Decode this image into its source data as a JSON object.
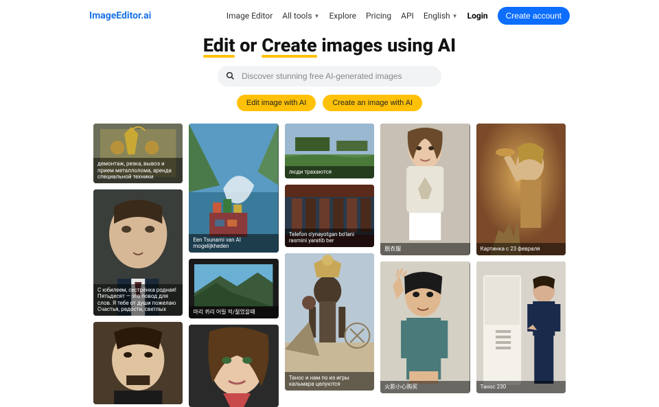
{
  "logo": "ImageEditor.ai",
  "nav": {
    "image_editor": "Image Editor",
    "all_tools": "All tools",
    "explore": "Explore",
    "pricing": "Pricing",
    "api": "API",
    "language": "English",
    "login": "Login",
    "create_account": "Create account"
  },
  "hero": {
    "w1": "Edit",
    "w2": "or",
    "w3": "Create",
    "w4": "images using AI"
  },
  "search": {
    "placeholder": "Discover stunning free AI-generated images"
  },
  "buttons": {
    "edit": "Edit image with AI",
    "create": "Create an image with AI"
  },
  "captions": {
    "c0": "демонтаж, резка, вывоз и прием металлолома, аренда специальной техники",
    "c1": "С юбилеем, сестрёнка родная! Пятьдесят — это повод для слов. Я тебе от души пожелаю Счастья, радости, светлых",
    "c2": "Een Tsunami van AI mogelijkheden",
    "c3": "마리 퀴리 어릴 적/젊었을때",
    "c4": "люди трахаются",
    "c5": "Telefon o'ynayotgan bo'lani rasmini yaratib ber",
    "c6": "Танос и нам по из игры кальмара целуются",
    "c7": "脱衣服",
    "c8": "火影小心购买",
    "c9": "Картинка с 23 февраля",
    "c10": "Танос 230"
  }
}
